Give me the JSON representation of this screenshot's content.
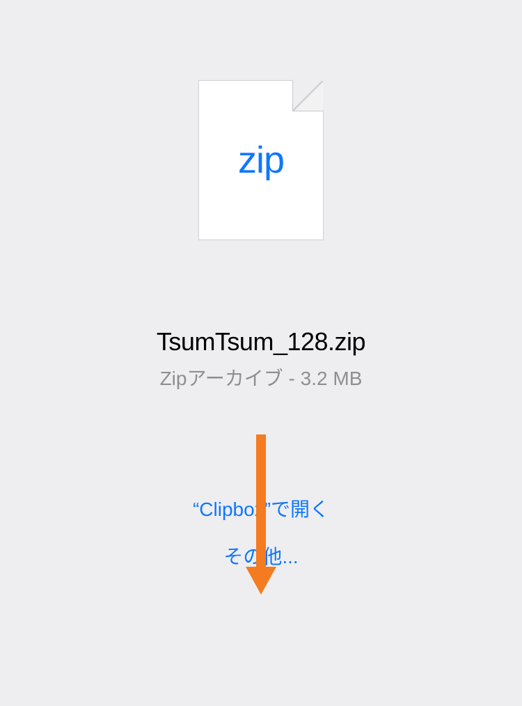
{
  "file": {
    "icon_label": "zip",
    "name": "TsumTsum_128.zip",
    "meta": "Zipアーカイブ - 3.2 MB"
  },
  "actions": {
    "open_with": "“Clipbox”で開く",
    "more": "その他..."
  },
  "colors": {
    "link": "#0f77ff",
    "arrow": "#f47b20"
  }
}
